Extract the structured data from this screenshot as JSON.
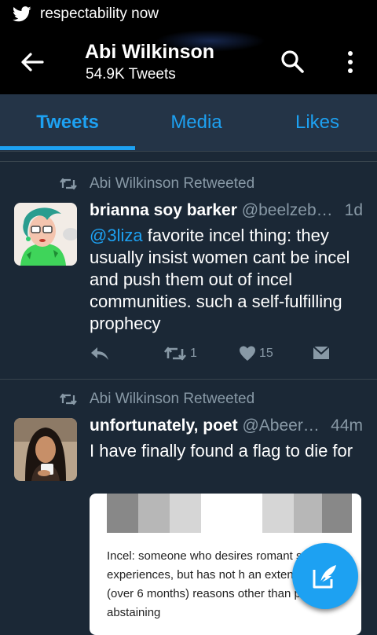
{
  "status_bar": {
    "notification_text": "respectability now"
  },
  "header": {
    "name": "Abi Wilkinson",
    "tweet_count": "54.9K Tweets"
  },
  "tabs": [
    {
      "label": "Tweets",
      "active": true
    },
    {
      "label": "Media",
      "active": false
    },
    {
      "label": "Likes",
      "active": false
    }
  ],
  "tweets": [
    {
      "retweeted_by": "Abi Wilkinson Retweeted",
      "author_name": "brianna soy barker",
      "handle": "@beelzeb…",
      "time": "1d",
      "mention": "@3liza",
      "text": " favorite incel thing: they usually insist women cant be incel and push them out of incel communities. such a self-fulfilling prophecy",
      "retweets": "1",
      "likes": "15"
    },
    {
      "retweeted_by": "Abi Wilkinson Retweeted",
      "author_name": "unfortunately, poet",
      "handle": "@Abeer…",
      "time": "44m",
      "text": "I have finally found a flag to die for",
      "card_text": "Incel: someone who desires romant sexual experiences, but has not h an extended time (over 6 months) reasons other than purposely abstaining"
    }
  ],
  "colors": {
    "accent": "#1da1f2",
    "background": "#1b2836",
    "muted": "#8899a6"
  }
}
